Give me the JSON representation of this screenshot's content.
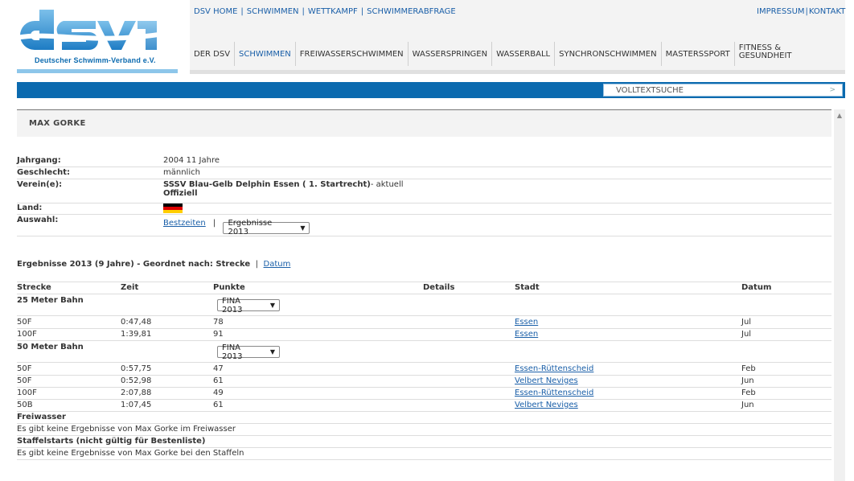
{
  "logo": {
    "subtitle": "Deutscher Schwimm-Verband e.V."
  },
  "top_links": [
    "DSV HOME",
    "SCHWIMMEN",
    "WETTKAMPF",
    "SCHWIMMERABFRAGE"
  ],
  "top_right_links": [
    "IMPRESSUM",
    "KONTAKT"
  ],
  "main_nav": [
    "DER DSV",
    "SCHWIMMEN",
    "FREIWASSERSCHWIMMEN",
    "WASSERSPRINGEN",
    "WASSERBALL",
    "SYNCHRONSCHWIMMEN",
    "MASTERSSPORT",
    "FITNESS & GESUNDHEIT"
  ],
  "search": {
    "label": "VOLLTEXTSUCHE"
  },
  "page_title": "MAX GORKE",
  "info": {
    "jahrgang_label": "Jahrgang:",
    "jahrgang_value": "2004 11 Jahre",
    "geschlecht_label": "Geschlecht:",
    "geschlecht_value": "männlich",
    "verein_label": "Verein(e):",
    "verein_name": "SSSV Blau-Gelb Delphin Essen ( 1. Startrecht)",
    "verein_status": "- aktuell",
    "verein_role": "Offiziell",
    "land_label": "Land:",
    "auswahl_label": "Auswahl:",
    "bestzeiten_link": "Bestzeiten",
    "auswahl_select": "Ergebnisse 2013"
  },
  "results": {
    "heading": "Ergebnisse 2013 (9 Jahre) - Geordnet nach: Strecke",
    "sep": "|",
    "datum_link": "Datum",
    "columns": [
      "Strecke",
      "Zeit",
      "Punkte",
      "Details",
      "Stadt",
      "Datum"
    ],
    "section_25": "25 Meter Bahn",
    "select_25": "FINA 2013",
    "rows_25": [
      {
        "strecke": "50F",
        "zeit": "0:47,48",
        "punkte": "78",
        "stadt": "Essen",
        "datum": "Jul"
      },
      {
        "strecke": "100F",
        "zeit": "1:39,81",
        "punkte": "91",
        "stadt": "Essen",
        "datum": "Jul"
      }
    ],
    "section_50": "50 Meter Bahn",
    "select_50": "FINA 2013",
    "rows_50": [
      {
        "strecke": "50F",
        "zeit": "0:57,75",
        "punkte": "47",
        "stadt": "Essen-Rüttenscheid",
        "datum": "Feb"
      },
      {
        "strecke": "50F",
        "zeit": "0:52,98",
        "punkte": "61",
        "stadt": "Velbert Neviges",
        "datum": "Jun"
      },
      {
        "strecke": "100F",
        "zeit": "2:07,88",
        "punkte": "49",
        "stadt": "Essen-Rüttenscheid",
        "datum": "Feb"
      },
      {
        "strecke": "50B",
        "zeit": "1:07,45",
        "punkte": "61",
        "stadt": "Velbert Neviges",
        "datum": "Jun"
      }
    ],
    "freiwasser_title": "Freiwasser",
    "freiwasser_text": "Es gibt keine Ergebnisse von Max Gorke im Freiwasser",
    "staffel_title": "Staffelstarts (nicht gültig für Bestenliste)",
    "staffel_text": "Es gibt keine Ergebnisse von Max Gorke bei den Staffeln"
  },
  "colors": {
    "brand_blue": "#0b6aaf",
    "logo_light_blue": "#8dc6ea",
    "link": "#1a5fa8"
  }
}
